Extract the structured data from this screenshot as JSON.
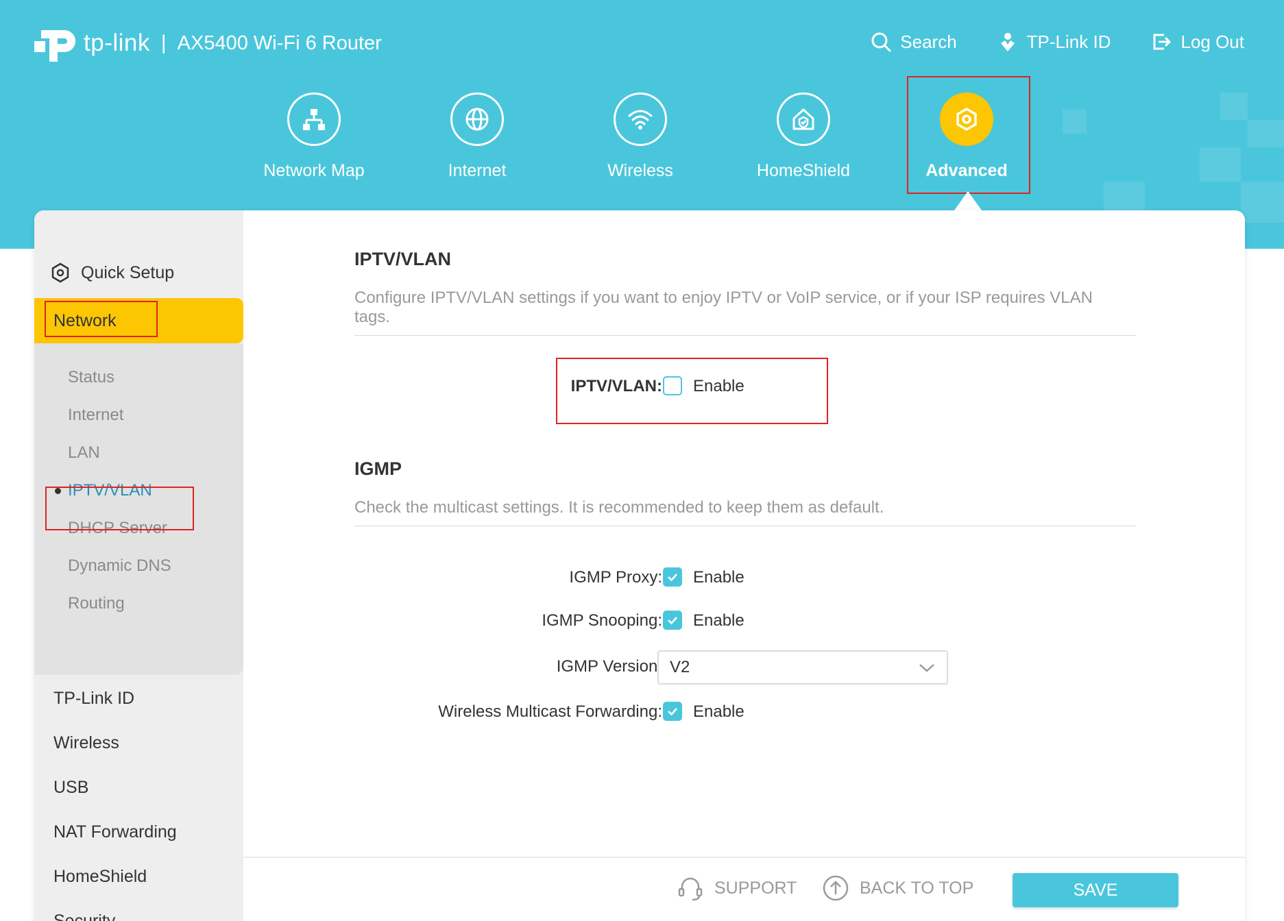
{
  "header": {
    "logo_text": "tp-link",
    "separator": "|",
    "model": "AX5400 Wi-Fi 6 Router",
    "links": {
      "search": "Search",
      "tplink_id": "TP-Link ID",
      "logout": "Log Out"
    },
    "icons": [
      "search-icon",
      "user-pin-icon",
      "logout-icon"
    ]
  },
  "nav": {
    "network_map": "Network Map",
    "internet": "Internet",
    "wireless": "Wireless",
    "homeshield": "HomeShield",
    "advanced": "Advanced",
    "active": "Advanced"
  },
  "sidebar": {
    "quick_setup": "Quick Setup",
    "network": "Network",
    "network_sub": {
      "status": "Status",
      "internet": "Internet",
      "lan": "LAN",
      "iptv": "IPTV/VLAN",
      "dhcp": "DHCP Server",
      "ddns": "Dynamic DNS",
      "routing": "Routing"
    },
    "main": {
      "tplink_id": "TP-Link ID",
      "wireless": "Wireless",
      "usb": "USB",
      "nat": "NAT Forwarding",
      "homeshield": "HomeShield",
      "security": "Security"
    }
  },
  "iptv": {
    "title": "IPTV/VLAN",
    "description": "Configure IPTV/VLAN settings if you want to enjoy IPTV or VoIP service, or if your ISP requires VLAN tags.",
    "field_label": "IPTV/VLAN:",
    "enable_label": "Enable",
    "enabled": false
  },
  "igmp": {
    "title": "IGMP",
    "description": "Check the multicast settings. It is recommended to keep them as default.",
    "proxy_label": "IGMP Proxy:",
    "proxy_enable": "Enable",
    "snooping_label": "IGMP Snooping:",
    "snooping_enable": "Enable",
    "version_label": "IGMP Version:",
    "version_value": "V2",
    "wmf_label": "Wireless Multicast Forwarding:",
    "wmf_enable": "Enable"
  },
  "footer": {
    "support": "SUPPORT",
    "back_to_top": "BACK TO TOP",
    "save": "SAVE"
  },
  "colors": {
    "brand_cyan": "#4ac6dc",
    "accent_yellow": "#fcc602",
    "highlight_red": "#e02222"
  }
}
